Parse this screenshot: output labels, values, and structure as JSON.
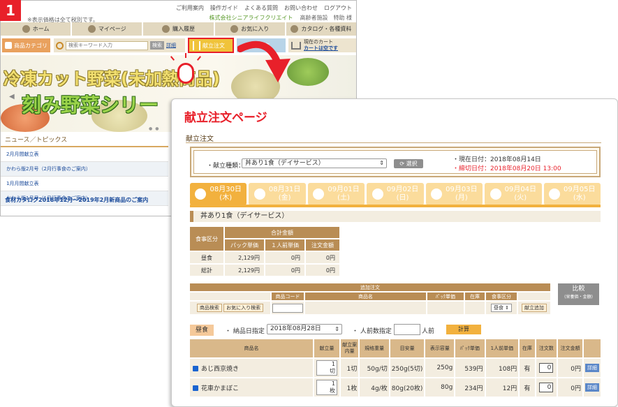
{
  "step": "1",
  "back": {
    "top_links": [
      "ご利用案内",
      "操作ガイド",
      "よくある質問",
      "お問い合わせ",
      "ログアウト"
    ],
    "note": "※表示価格は全て税別です。",
    "company": "株式会社シニアライフクリエイト",
    "facility": "高齢者施設　特助 様",
    "nav": [
      "ホーム",
      "マイページ",
      "購入履歴",
      "お気に入り",
      "カタログ・各種資料"
    ],
    "category_label": "商品カテゴリ",
    "search_placeholder": "検索キーワード入力",
    "search_button": "検索",
    "detail_link": "詳細",
    "kondate_label": "献立注文",
    "ochu_label": "て注文",
    "cart_label": "現在のカート",
    "cart_status": "カートは空です",
    "banner_line1": "冷凍カット野菜(未加熱商品)",
    "banner_line2": "刻み野菜シリー",
    "news_title": "ニュース／トピックス",
    "news_items": [
      "2月月間献立表",
      "かわら版2月号（2月行事食のご案内）",
      "1月月間献立表",
      "かわら版1月号（1月行事食のご案内）"
    ],
    "catalog_link": "食材カタログ2018年12月～2019年2月新商品のご案内"
  },
  "front": {
    "page_title": "献立注文ページ",
    "section": "献立注文",
    "type_label": "・献立種類：",
    "type_value": "丼あり1食（デイサービス）",
    "select_button": "選択",
    "current_date": "・現在日付：2018年08月14日",
    "deadline": "・締切日付：2018年08月20日 13:00",
    "days": [
      {
        "date": "08月30日",
        "dow": "(木)"
      },
      {
        "date": "08月31日",
        "dow": "(金)"
      },
      {
        "date": "09月01日",
        "dow": "(土)"
      },
      {
        "date": "09月02日",
        "dow": "(日)"
      },
      {
        "date": "09月03日",
        "dow": "(月)"
      },
      {
        "date": "09月04日",
        "dow": "(火)"
      },
      {
        "date": "09月05日",
        "dow": "(水)"
      }
    ],
    "menu_heading": "丼あり1食（デイサービス）",
    "summary": {
      "h_kubun": "食事区分",
      "h_total": "合計金額",
      "h_pack": "パック単価",
      "h_person": "１人前単価",
      "h_order": "注文金額",
      "rows": [
        {
          "label": "昼食",
          "pack": "2,129円",
          "person": "0円",
          "order": "0円"
        },
        {
          "label": "総計",
          "pack": "2,129円",
          "person": "0円",
          "order": "0円"
        }
      ]
    },
    "add": {
      "title": "追加注文",
      "h_code": "商品コード",
      "h_name": "商品名",
      "h_pack": "ﾊﾟｯｸ単価",
      "h_stock": "在庫",
      "h_kubun": "食事区分",
      "search_btn": "商品検索",
      "fav_btn": "お気に入り検索",
      "kubun_value": "昼食",
      "add_btn": "献立追加"
    },
    "compare_title": "比較",
    "compare_sub": "(栄養価・金額)",
    "meal_tag": "昼食",
    "delivery_label": "・ 納品日指定",
    "delivery_value": "2018年08月28日",
    "persons_label": "・ 人前数指定",
    "persons_unit": "人前",
    "calc_button": "計算",
    "items_headers": [
      "商品名",
      "献立量",
      "献立案内量",
      "規格重量",
      "目安量",
      "表示容量",
      "ﾊﾟｯｸ単価",
      "1人前単価",
      "在庫",
      "注文数",
      "注文金額",
      ""
    ],
    "items": [
      {
        "name": "あじ西京焼き",
        "qty1": "1",
        "qty2": "切",
        "plan": "1切",
        "spec": "50g/切",
        "guide": "250g(5切)",
        "disp": "250g",
        "pack": "539円",
        "person": "108円",
        "stock": "有",
        "order": "0",
        "amount": "0円",
        "detail": "詳細"
      },
      {
        "name": "花車かまぼこ",
        "qty1": "1",
        "qty2": "枚",
        "plan": "1枚",
        "spec": "4g/枚",
        "guide": "80g(20枚)",
        "disp": "80g",
        "pack": "234円",
        "person": "12円",
        "stock": "有",
        "order": "0",
        "amount": "0円",
        "detail": "詳細"
      }
    ]
  }
}
